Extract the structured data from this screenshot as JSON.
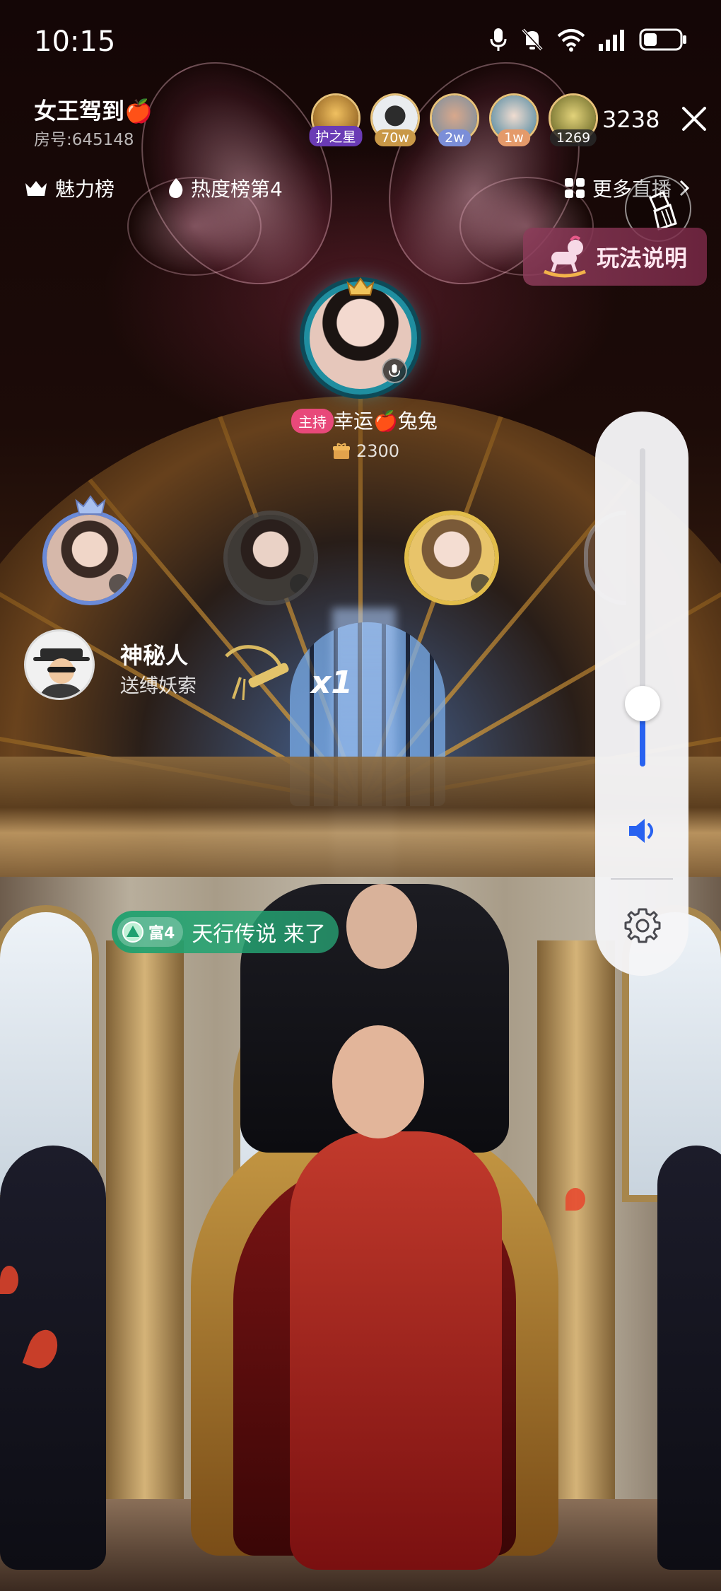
{
  "status_bar": {
    "time": "10:15"
  },
  "header": {
    "room_title": "女王驾到🍎",
    "room_id": "房号:645148",
    "viewers": [
      {
        "badge": "护之星",
        "badge_color": "#6a3bb5",
        "face_color": "#c7902e"
      },
      {
        "badge": "70w",
        "badge_color": "#d2a04a",
        "face_color": "#dfe3e8"
      },
      {
        "badge": "2w",
        "badge_color": "#7b8ed8",
        "face_color": "#c99a80"
      },
      {
        "badge": "1w",
        "badge_color": "#e49a6a",
        "face_color": "#4f8aa8"
      },
      {
        "badge": "1269",
        "badge_color": "#3d3d3d",
        "face_color": "#a8a048"
      }
    ],
    "viewer_count": "3238",
    "charm_rank": "魅力榜",
    "heat_rank": "热度榜第4",
    "more_live": "更多直播"
  },
  "rules_button": {
    "label": "玩法说明"
  },
  "host": {
    "tag": "主持",
    "name": "幸运🍎兔兔",
    "score": "2300"
  },
  "gift_banner": {
    "user": "神秘人",
    "action": "送缚妖索",
    "count": "x1"
  },
  "entrance": {
    "level": "富4",
    "text": "天行传说 来了"
  },
  "volume": {
    "level": 0.11,
    "accent": "#2862f0"
  }
}
